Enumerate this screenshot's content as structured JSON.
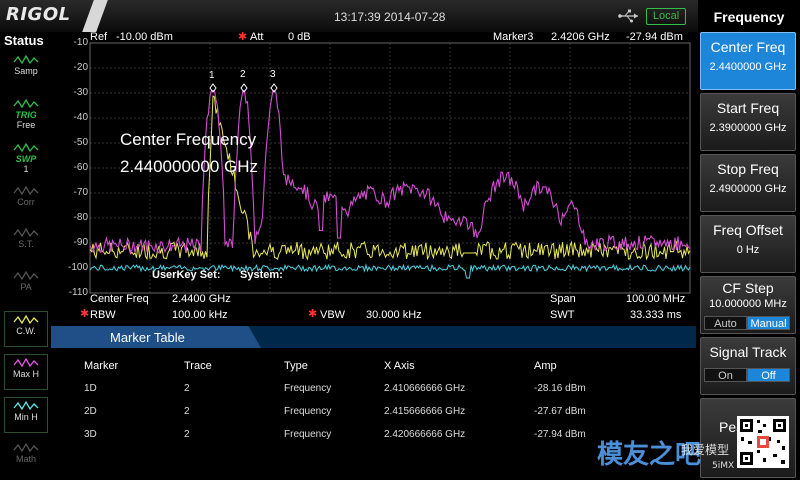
{
  "header": {
    "logo": "RIGOL",
    "datetime": "13:17:39 2014-07-28",
    "interface": "Local"
  },
  "status_panel": {
    "title": "Status",
    "items": [
      {
        "label": "Samp",
        "icon": "sample-wave-icon",
        "color": "#2fbf4a"
      },
      {
        "label": "TRIG\nFree",
        "icon": "trigger-icon",
        "color": "#2fbf4a"
      },
      {
        "label": "SWP\n1",
        "icon": "sweep-icon",
        "color": "#2fbf4a"
      },
      {
        "label": "Corr",
        "icon": "correction-icon",
        "color": "#555555"
      },
      {
        "label": "S.T.",
        "icon": "source-track-icon",
        "color": "#555555"
      },
      {
        "label": "PA",
        "icon": "preamp-icon",
        "color": "#555555"
      },
      {
        "label": "C.W.",
        "icon": "clear-write-icon",
        "color": "#e8e85a"
      },
      {
        "label": "Max H",
        "icon": "max-hold-icon",
        "color": "#e85ae8"
      },
      {
        "label": "Min H",
        "icon": "min-hold-icon",
        "color": "#5ae8e8"
      },
      {
        "label": "Math",
        "icon": "math-icon",
        "color": "#555555"
      }
    ]
  },
  "trace": {
    "ref_label": "Ref",
    "ref_value": "-10.00 dBm",
    "att_label": "Att",
    "att_value": "0 dB",
    "marker_label": "Marker3",
    "marker_freq": "2.4206 GHz",
    "marker_amp": "-27.94 dBm",
    "y_ticks": [
      "-10",
      "-20",
      "-30",
      "-40",
      "-50",
      "-60",
      "-70",
      "-80",
      "-90",
      "-100",
      "-110"
    ],
    "overlay_line1": "Center Frequency",
    "overlay_line2": "2.440000000 GHz",
    "userkey": "UserKey Set:",
    "system": "System:",
    "marker_numbers": [
      "1",
      "2",
      "3"
    ]
  },
  "info_bar": {
    "center_label": "Center Freq",
    "center_value": "2.4400 GHz",
    "span_label": "Span",
    "span_value": "100.00 MHz",
    "rbw_label": "RBW",
    "rbw_value": "100.00 kHz",
    "vbw_label": "VBW",
    "vbw_value": "30.000 kHz",
    "swt_label": "SWT",
    "swt_value": "33.333 ms"
  },
  "marker_table": {
    "title": "Marker Table",
    "columns": [
      "Marker",
      "Trace",
      "Type",
      "X Axis",
      "Amp"
    ],
    "rows": [
      {
        "marker": "1D",
        "trace": "2",
        "type": "Frequency",
        "x": "2.410666666 GHz",
        "amp": "-28.16 dBm"
      },
      {
        "marker": "2D",
        "trace": "2",
        "type": "Frequency",
        "x": "2.415666666 GHz",
        "amp": "-27.67 dBm"
      },
      {
        "marker": "3D",
        "trace": "2",
        "type": "Frequency",
        "x": "2.420666666 GHz",
        "amp": "-27.94 dBm"
      }
    ]
  },
  "menu": {
    "title": "Frequency",
    "center": {
      "label": "Center Freq",
      "value": "2.4400000 GHz"
    },
    "start": {
      "label": "Start Freq",
      "value": "2.3900000 GHz"
    },
    "stop": {
      "label": "Stop Freq",
      "value": "2.4900000 GHz"
    },
    "offset": {
      "label": "Freq Offset",
      "value": "0 Hz"
    },
    "cfstep": {
      "label": "CF Step",
      "value": "10.000000 MHz",
      "opt_auto": "Auto",
      "opt_manual": "Manual"
    },
    "signal": {
      "label": "Signal Track",
      "opt_on": "On",
      "opt_off": "Off"
    },
    "peak_partial": "Pea"
  },
  "watermark": {
    "text1": "模友之吧",
    "text2": "我爱模型",
    "text3": "5iMX"
  },
  "colors": {
    "trace_yellow": "#e8e85a",
    "trace_magenta": "#d24fd2",
    "trace_cyan": "#4ccfe0",
    "accent_blue": "#1e86d8",
    "local_green": "#2fbf4a"
  }
}
